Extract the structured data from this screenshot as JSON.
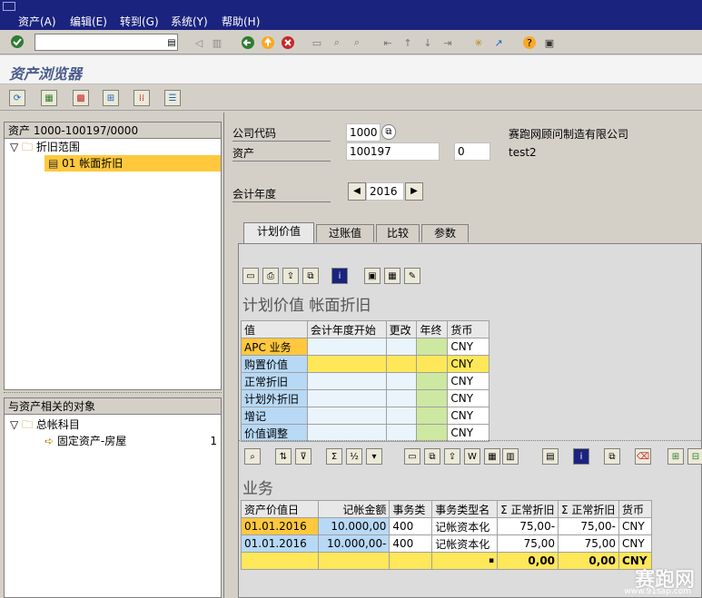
{
  "menubar": {
    "items": [
      "资产(A)",
      "编辑(E)",
      "转到(G)",
      "系统(Y)",
      "帮助(H)"
    ]
  },
  "command_field": {
    "value": ""
  },
  "title": "资产浏览器",
  "left_tree": {
    "header": "资产 1000-100197/0000",
    "nodes": [
      {
        "label": "折旧范围"
      },
      {
        "label": "01  帐面折旧"
      }
    ]
  },
  "related_tree": {
    "header": "与资产相关的对象",
    "nodes": [
      {
        "label": "总帐科目"
      },
      {
        "label": "固定资产-房屋",
        "count": "1"
      }
    ]
  },
  "fields": {
    "company_code_label": "公司代码",
    "company_code": "1000",
    "company_name": "赛跑网顾问制造有限公司",
    "asset_label": "资产",
    "asset": "100197",
    "sub_number": "0",
    "asset_desc": "test2",
    "fiscal_year_label": "会计年度",
    "fiscal_year": "2016"
  },
  "tabs": [
    {
      "label": "计划价值",
      "active": true
    },
    {
      "label": "过账值",
      "active": false
    },
    {
      "label": "比较",
      "active": false
    },
    {
      "label": "参数",
      "active": false
    }
  ],
  "plan_section": {
    "title": "计划价值 帐面折旧",
    "columns": [
      "值",
      "会计年度开始",
      "更改",
      "年终",
      "货币"
    ],
    "rows": [
      {
        "label": "APC 业务",
        "currency": "CNY"
      },
      {
        "label": "购置价值",
        "currency": "CNY"
      },
      {
        "label": "正常折旧",
        "currency": "CNY"
      },
      {
        "label": "计划外折旧",
        "currency": "CNY"
      },
      {
        "label": "增记",
        "currency": "CNY"
      },
      {
        "label": "价值调整",
        "currency": "CNY"
      }
    ]
  },
  "txn_section": {
    "title": "业务",
    "columns": [
      "资产价值日",
      "记帐金额",
      "事务类",
      "事务类型名",
      "Σ 正常折旧",
      "Σ 正常折旧",
      "货币"
    ],
    "rows": [
      {
        "date": "01.01.2016",
        "amount": "10.000,00",
        "type": "400",
        "type_name": "记帐资本化",
        "dep1": "75,00-",
        "dep2": "75,00-",
        "currency": "CNY"
      },
      {
        "date": "01.01.2016",
        "amount": "10.000,00-",
        "type": "400",
        "type_name": "记帐资本化",
        "dep1": "75,00",
        "dep2": "75,00",
        "currency": "CNY"
      }
    ],
    "totals": {
      "dep1": "0,00",
      "dep2": "0,00",
      "currency": "CNY",
      "mark1": "▪",
      "mark2": "▪"
    }
  },
  "watermark": {
    "text": "赛跑网",
    "url": "www.91sap.com"
  },
  "colors": {
    "menubar": "#1a237e",
    "selection": "#ffc83d",
    "sum_row": "#ffe75a"
  }
}
